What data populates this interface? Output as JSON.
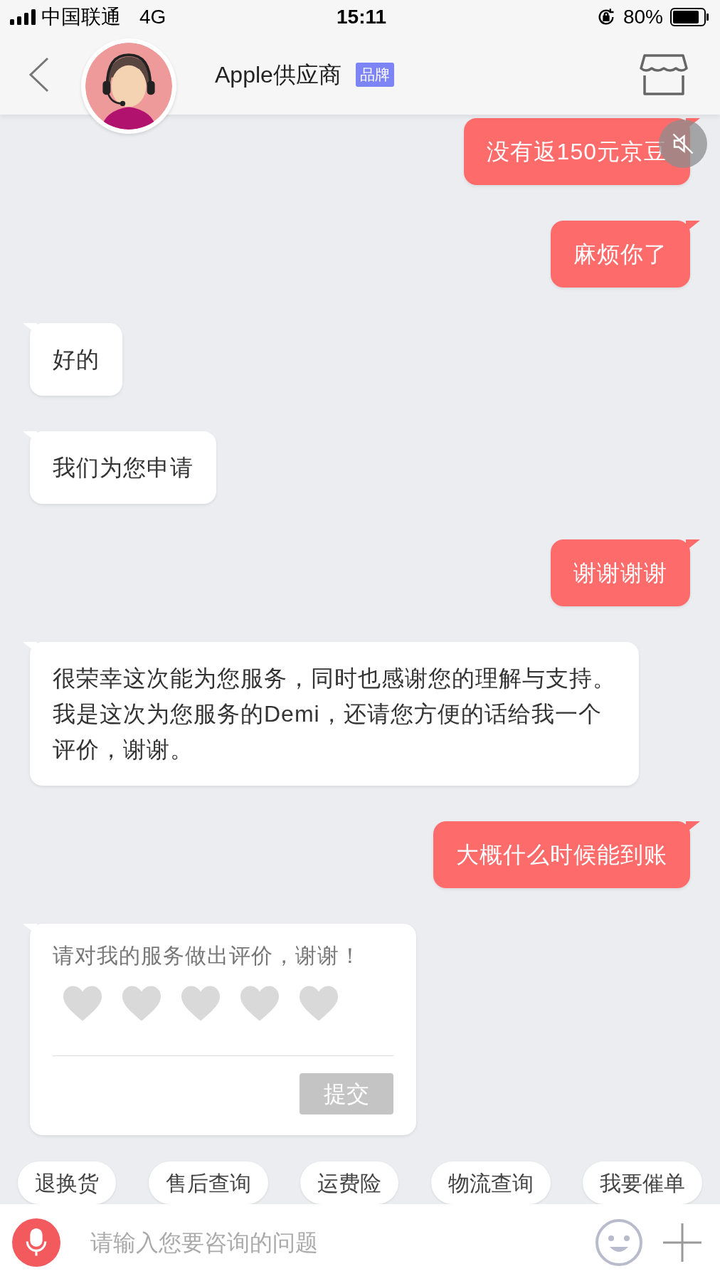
{
  "status_bar": {
    "carrier": "中国联通",
    "network": "4G",
    "time": "15:11",
    "battery": "80%"
  },
  "header": {
    "title": "Apple供应商",
    "badge": "品牌"
  },
  "messages": [
    {
      "kind": "outgoing",
      "text": "没有返150元京豆",
      "muted_overlay": true
    },
    {
      "kind": "outgoing",
      "text": "麻烦你了",
      "muted_overlay": false
    },
    {
      "kind": "incoming",
      "text": "好的"
    },
    {
      "kind": "incoming",
      "text": "我们为您申请"
    },
    {
      "kind": "outgoing",
      "text": "谢谢谢谢",
      "muted_overlay": false
    },
    {
      "kind": "incoming",
      "text": "很荣幸这次能为您服务，同时也感谢您的理解与支持。我是这次为您服务的Demi，还请您方便的话给我一个评价，谢谢。"
    },
    {
      "kind": "outgoing",
      "text": "大概什么时候能到账",
      "muted_overlay": false
    },
    {
      "kind": "rating",
      "text": "请对我的服务做出评价，谢谢！",
      "stars": 0,
      "submit": {
        "label": "提交",
        "disabled": true
      }
    }
  ],
  "quick_replies": [
    "退换货",
    "售后查询",
    "运费险",
    "物流查询",
    "我要催单"
  ],
  "input": {
    "placeholder": "请输入您要咨询的问题"
  }
}
